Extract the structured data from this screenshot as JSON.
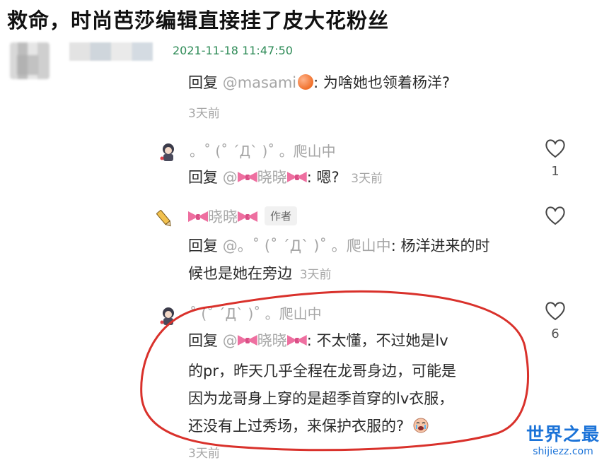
{
  "headline": "救命，时尚芭莎编辑直接挂了皮大花粉丝",
  "post": {
    "timestamp": "2021-11-18 11:47:50"
  },
  "reply1": {
    "prefix": "回复",
    "mention": "@masami",
    "emoji": "peach",
    "text": ": 为啥她也领着杨洋?",
    "time": "3天前"
  },
  "reply2": {
    "name": "。˚ (˚ ˊДˋ )˚ 。爬山中",
    "prefix": "回复",
    "mention_at": "@",
    "mention_name": "晓晓",
    "text": ": 嗯?",
    "time": "3天前",
    "likes": "1"
  },
  "reply3": {
    "name": "晓晓",
    "author_tag": "作者",
    "prefix": "回复",
    "mention": "@。˚ (˚ ˊДˋ )˚ 。爬山中",
    "line1": ": 杨洋进来的时",
    "line2": "候也是她在旁边",
    "time": "3天前"
  },
  "reply4": {
    "name": "˚ (˚ ˊДˋ )˚ 。爬山中",
    "prefix": "回复",
    "mention_at": "@",
    "mention_name": "晓晓",
    "line1": ": 不太懂，不过她是lv",
    "line2": "的pr，昨天几乎全程在龙哥身边，可能是",
    "line3": "因为龙哥身上穿的是超季首穿的lv衣服，",
    "line4": "还没有上过秀场，来保护衣服的?",
    "time": "3天前",
    "likes": "6"
  },
  "watermark": {
    "title": "世界之最",
    "domain": "shijiezz.com"
  },
  "icons": [
    "heart-icon",
    "pencil-icon",
    "bow-emoji",
    "peach-emoji",
    "crying-emoji"
  ],
  "colors": {
    "timestamp": "#2e8b57",
    "muted": "#a6a6a6",
    "bow": "#ee6fa0",
    "highlight_ring": "#d9312b",
    "watermark": "#1b73d8"
  }
}
